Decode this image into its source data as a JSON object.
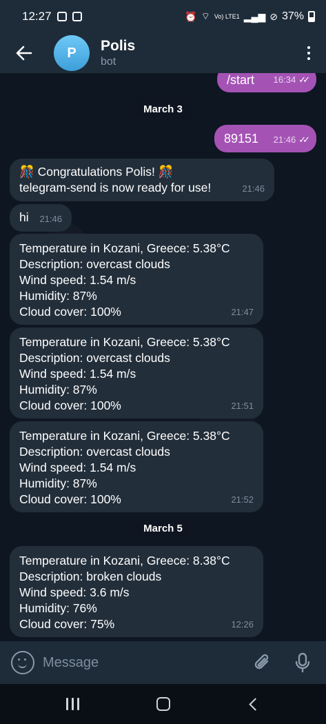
{
  "status_bar": {
    "time": "12:27",
    "battery": "37%",
    "signal_label": "Vo) LTE1"
  },
  "header": {
    "avatar_letter": "P",
    "title": "Polis",
    "subtitle": "bot"
  },
  "date_separators": [
    "March 3",
    "March 5"
  ],
  "messages": [
    {
      "dir": "out",
      "text": "/start",
      "time": "16:34",
      "read": true
    },
    {
      "dir": "out",
      "text": "89151",
      "time": "21:46",
      "read": true
    },
    {
      "dir": "in",
      "text": "🎊 Congratulations Polis! 🎊\ntelegram-send is now ready for use!",
      "time": "21:46"
    },
    {
      "dir": "in",
      "text": "hi",
      "time": "21:46"
    },
    {
      "dir": "in",
      "text": "Temperature in Kozani, Greece: 5.38°C\nDescription: overcast clouds\nWind speed: 1.54 m/s\nHumidity: 87%\nCloud cover: 100%",
      "time": "21:47"
    },
    {
      "dir": "in",
      "text": "Temperature in Kozani, Greece: 5.38°C\nDescription: overcast clouds\nWind speed: 1.54 m/s\nHumidity: 87%\nCloud cover: 100%",
      "time": "21:51"
    },
    {
      "dir": "in",
      "text": "Temperature in Kozani, Greece: 5.38°C\nDescription: overcast clouds\nWind speed: 1.54 m/s\nHumidity: 87%\nCloud cover: 100%",
      "time": "21:52"
    },
    {
      "dir": "in",
      "text": "Temperature in Kozani, Greece: 8.38°C\nDescription: broken clouds\nWind speed: 3.6 m/s\nHumidity: 76%\nCloud cover: 75%",
      "time": "12:26"
    }
  ],
  "composer": {
    "placeholder": "Message"
  },
  "icons": {
    "back": "arrow-left-icon",
    "menu": "more-vertical-icon",
    "emoji": "emoji-icon",
    "attach": "paperclip-icon",
    "mic": "microphone-icon"
  },
  "colors": {
    "outgoing_bubble": "#a453b5",
    "incoming_bubble": "#222e3a",
    "header": "#1e2c3a",
    "background": "#0e1621"
  }
}
